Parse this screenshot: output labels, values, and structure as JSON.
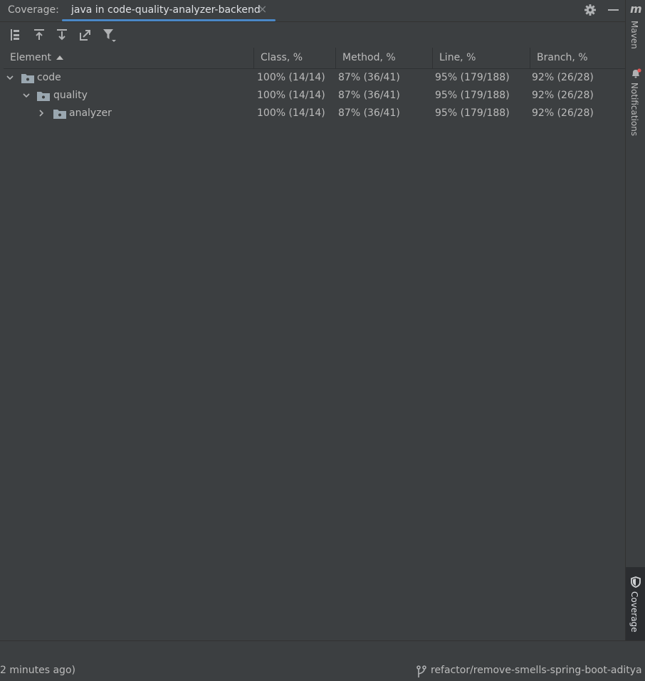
{
  "header": {
    "coverage_label": "Coverage:",
    "tab_title": "java in code-quality-analyzer-backend",
    "close_glyph": "×"
  },
  "toolbar": {
    "buttons": [
      "hierarchy-icon",
      "export-up-icon",
      "import-down-icon",
      "navigate-icon",
      "filter-icon"
    ]
  },
  "table": {
    "columns": [
      "Element",
      "Class, %",
      "Method, %",
      "Line, %",
      "Branch, %"
    ],
    "sort_column": "Element",
    "rows": [
      {
        "name": "code",
        "expanded": true,
        "class": "100% (14/14)",
        "method": "87% (36/41)",
        "line": "95% (179/188)",
        "branch": "92% (26/28)"
      },
      {
        "name": "quality",
        "expanded": true,
        "class": "100% (14/14)",
        "method": "87% (36/41)",
        "line": "95% (179/188)",
        "branch": "92% (26/28)"
      },
      {
        "name": "analyzer",
        "expanded": false,
        "class": "100% (14/14)",
        "method": "87% (36/41)",
        "line": "95% (179/188)",
        "branch": "92% (26/28)"
      }
    ]
  },
  "sidebar": {
    "maven_icon_text": "m",
    "maven_label": "Maven",
    "notifications_label": "Notifications",
    "coverage_label": "Coverage"
  },
  "status": {
    "left_text": "2 minutes ago)",
    "branch": "refactor/remove-smells-spring-boot-aditya"
  },
  "colors": {
    "background": "#3c3f41",
    "accent": "#4a88c7",
    "text": "#bbbbbb",
    "notification_dot": "#e05555"
  }
}
